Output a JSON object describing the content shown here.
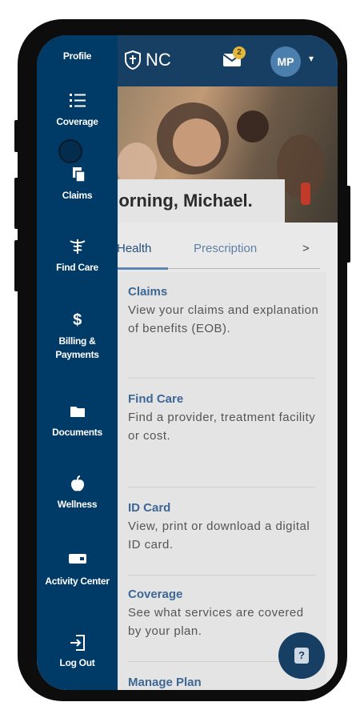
{
  "header": {
    "logo_text": "NC",
    "notification_count": "2",
    "avatar_initials": "MP"
  },
  "greeting": "Morning, Michael.",
  "tabs": [
    {
      "label": "Health"
    },
    {
      "label": "Prescription"
    },
    {
      "label": ">"
    }
  ],
  "content_items": [
    {
      "title": "Claims",
      "description": "View your claims and explanation of benefits (EOB)."
    },
    {
      "title": "Find Care",
      "description": "Find a provider, treatment facility or cost."
    },
    {
      "title": "ID Card",
      "description": "View, print or download a digital ID card."
    },
    {
      "title": "Coverage",
      "description": "See what services are covered by your plan."
    },
    {
      "title": "Manage Plan",
      "description": ""
    }
  ],
  "drawer": {
    "items": [
      {
        "label": "Profile",
        "icon": "profile-icon"
      },
      {
        "label": "Coverage",
        "icon": "list-icon"
      },
      {
        "label": "Claims",
        "icon": "documents-icon"
      },
      {
        "label": "Find Care",
        "icon": "caduceus-icon"
      },
      {
        "label": "Billing & Payments",
        "icon": "dollar-icon"
      },
      {
        "label": "Documents",
        "icon": "folder-icon"
      },
      {
        "label": "Wellness",
        "icon": "apple-icon"
      },
      {
        "label": "Activity Center",
        "icon": "card-icon"
      },
      {
        "label": "Log Out",
        "icon": "logout-icon"
      }
    ]
  },
  "colors": {
    "drawer": "#003a66",
    "header": "#173f64",
    "link": "#3d6795",
    "badge": "#e2b73d"
  }
}
